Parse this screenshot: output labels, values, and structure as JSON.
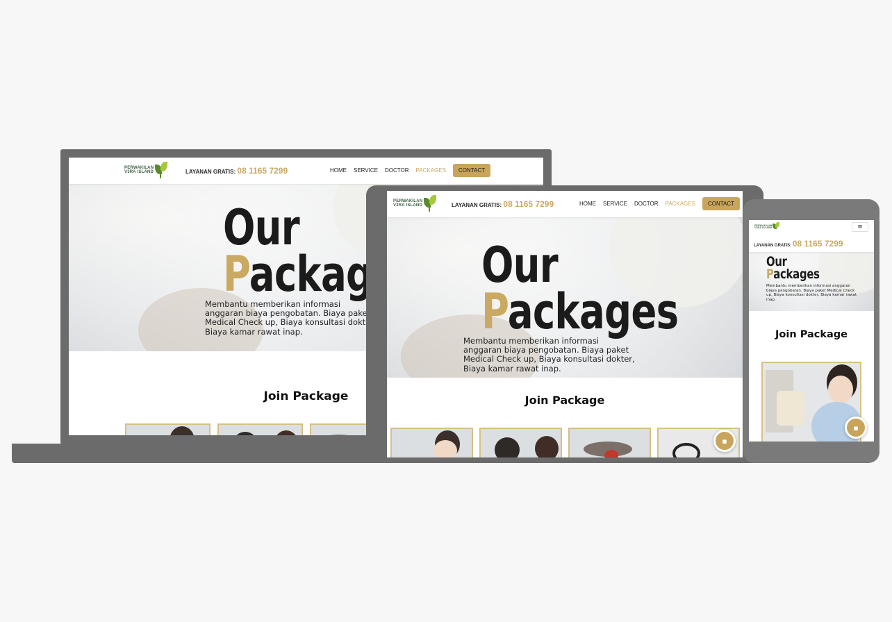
{
  "site": {
    "logo_line1": "PERWAKILAN",
    "logo_line2": "V3RA ISLAND",
    "hotline_label": "LAYANAN GRATIS:",
    "hotline_number": "08 1165 7299",
    "nav": {
      "home": "HOME",
      "service": "SERVICE",
      "doctor": "DOCTOR",
      "packages": "PACKAGES",
      "contact": "CONTACT"
    },
    "menu_glyph": "≡"
  },
  "hero": {
    "title_line1": "Our",
    "title_initial": "P",
    "title_rest": "ackages",
    "desc_line1": "Membantu memberikan informasi",
    "desc_line2": "anggaran biaya pengobatan. Biaya paket",
    "desc_line3": "Medical Check up, Biaya konsultasi dokter,",
    "desc_line4": "Biaya kamar rawat inap.",
    "desc_phone": "Membantu memberikan informasi anggaran biaya pengobatan. Biaya paket Medical Check up, Biaya konsultasi dokter, Biaya kamar rawat inap."
  },
  "section": {
    "join_title": "Join Package"
  },
  "colors": {
    "gold": "#caa962",
    "contact_bg": "#c9a55b",
    "device_frame": "#6b6b6b",
    "card_border": "#d7bf86"
  },
  "icons": {
    "chat": "chat-bubble-icon",
    "menu": "hamburger-menu-icon",
    "logo": "leaf-logo-icon"
  }
}
